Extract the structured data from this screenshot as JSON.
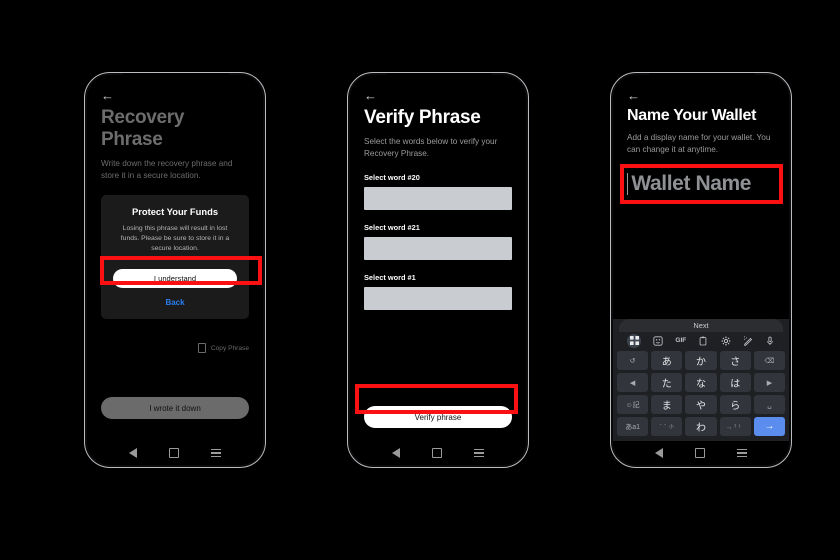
{
  "screens": [
    {
      "id": "recovery-phrase",
      "back_icon": "back-arrow-icon",
      "title": "Recovery Phrase",
      "subtitle": "Write down the recovery phrase and store it in a secure location.",
      "dialog": {
        "title": "Protect Your Funds",
        "body": "Losing this phrase will result in lost funds. Please be sure to store it in a secure location.",
        "primary_label": "I understand",
        "secondary_label": "Back"
      },
      "copy_label": "Copy Phrase",
      "copy_icon": "copy-icon",
      "footer_button": "I wrote it down"
    },
    {
      "id": "verify-phrase",
      "back_icon": "back-arrow-icon",
      "title": "Verify Phrase",
      "subtitle": "Select the words below to verify your Recovery Phrase.",
      "fields": [
        {
          "label": "Select word #20",
          "value": ""
        },
        {
          "label": "Select word #21",
          "value": ""
        },
        {
          "label": "Select word #1",
          "value": ""
        }
      ],
      "footer_button": "Verify phrase"
    },
    {
      "id": "name-your-wallet",
      "back_icon": "back-arrow-icon",
      "title": "Name Your Wallet",
      "subtitle": "Add a display name for your wallet. You can change it at anytime.",
      "name_field": {
        "value": "",
        "placeholder": "Wallet Name"
      },
      "keyboard": {
        "suggestion": "Next",
        "tools": [
          "apps-grid-icon",
          "sticker-icon",
          "gif-icon",
          "clipboard-icon",
          "settings-gear-icon",
          "handwriting-icon",
          "microphone-icon"
        ],
        "gif_label": "GIF",
        "rows": [
          [
            {
              "g": "↺",
              "t": "small"
            },
            {
              "g": "あ",
              "t": "kana"
            },
            {
              "g": "か",
              "t": "kana"
            },
            {
              "g": "さ",
              "t": "kana"
            },
            {
              "g": "⌫",
              "t": "small"
            }
          ],
          [
            {
              "g": "◀",
              "t": "small"
            },
            {
              "g": "た",
              "t": "kana"
            },
            {
              "g": "な",
              "t": "kana"
            },
            {
              "g": "は",
              "t": "kana"
            },
            {
              "g": "▶",
              "t": "small"
            }
          ],
          [
            {
              "g": "☺記",
              "t": "small"
            },
            {
              "g": "ま",
              "t": "kana"
            },
            {
              "g": "や",
              "t": "kana"
            },
            {
              "g": "ら",
              "t": "kana"
            },
            {
              "g": "␣",
              "t": "small"
            }
          ],
          [
            {
              "g": "あa1",
              "t": "small"
            },
            {
              "g": "゛゜小",
              "t": "tiny"
            },
            {
              "g": "わ",
              "t": "kana"
            },
            {
              "g": "、。？！",
              "t": "tiny"
            },
            {
              "g": "→",
              "t": "enter"
            }
          ]
        ]
      }
    }
  ],
  "nav_bar": {
    "back_icon": "nav-back-icon",
    "home_icon": "nav-home-icon",
    "recents_icon": "nav-recents-icon"
  },
  "annotations": {
    "color": "#fb1111",
    "count": 4
  },
  "background_color": "#000000"
}
